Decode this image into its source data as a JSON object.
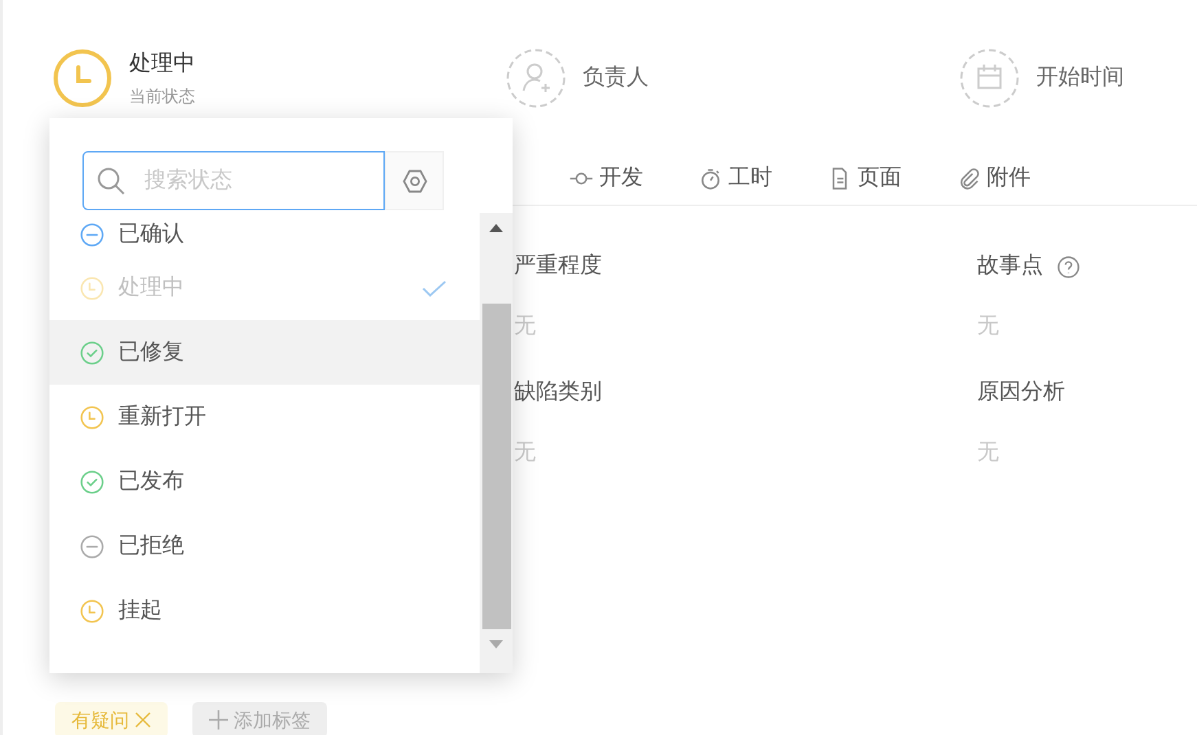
{
  "header": {
    "status": {
      "title": "处理中",
      "subtitle": "当前状态"
    },
    "assignee": {
      "label": "负责人"
    },
    "start_time": {
      "label": "开始时间"
    }
  },
  "tabs": [
    {
      "label": "开发",
      "kind": "commit",
      "selected": false
    },
    {
      "label": "工时",
      "kind": "timer",
      "selected": false
    },
    {
      "label": "页面",
      "kind": "page",
      "selected": false
    },
    {
      "label": "附件",
      "kind": "clip",
      "selected": false
    }
  ],
  "fields": [
    {
      "label": "严重程度",
      "value": "无",
      "help": false
    },
    {
      "label": "故事点",
      "value": "无",
      "help": true
    },
    {
      "label": "缺陷类别",
      "value": "无",
      "help": false
    },
    {
      "label": "原因分析",
      "value": "无",
      "help": false
    }
  ],
  "tags": [
    {
      "label": "有疑问"
    }
  ],
  "add_tag": "添加标签",
  "dropdown": {
    "search": {
      "placeholder": "搜索状态"
    },
    "options": [
      {
        "label": "已确认",
        "kind": "minus",
        "color": "#5ea8f5",
        "selected": false,
        "hovered": false
      },
      {
        "label": "处理中",
        "kind": "clock",
        "color": "#fae6b0",
        "selected": true,
        "hovered": false
      },
      {
        "label": "已修复",
        "kind": "check",
        "color": "#6bcf8a",
        "selected": false,
        "hovered": true
      },
      {
        "label": "重新打开",
        "kind": "clock",
        "color": "#f2c44f",
        "selected": false,
        "hovered": false
      },
      {
        "label": "已发布",
        "kind": "check",
        "color": "#6bcf8a",
        "selected": false,
        "hovered": false
      },
      {
        "label": "已拒绝",
        "kind": "minus",
        "color": "#aaaaaa",
        "selected": false,
        "hovered": false
      },
      {
        "label": "挂起",
        "kind": "clock",
        "color": "#f2c44f",
        "selected": false,
        "hovered": false
      }
    ]
  }
}
